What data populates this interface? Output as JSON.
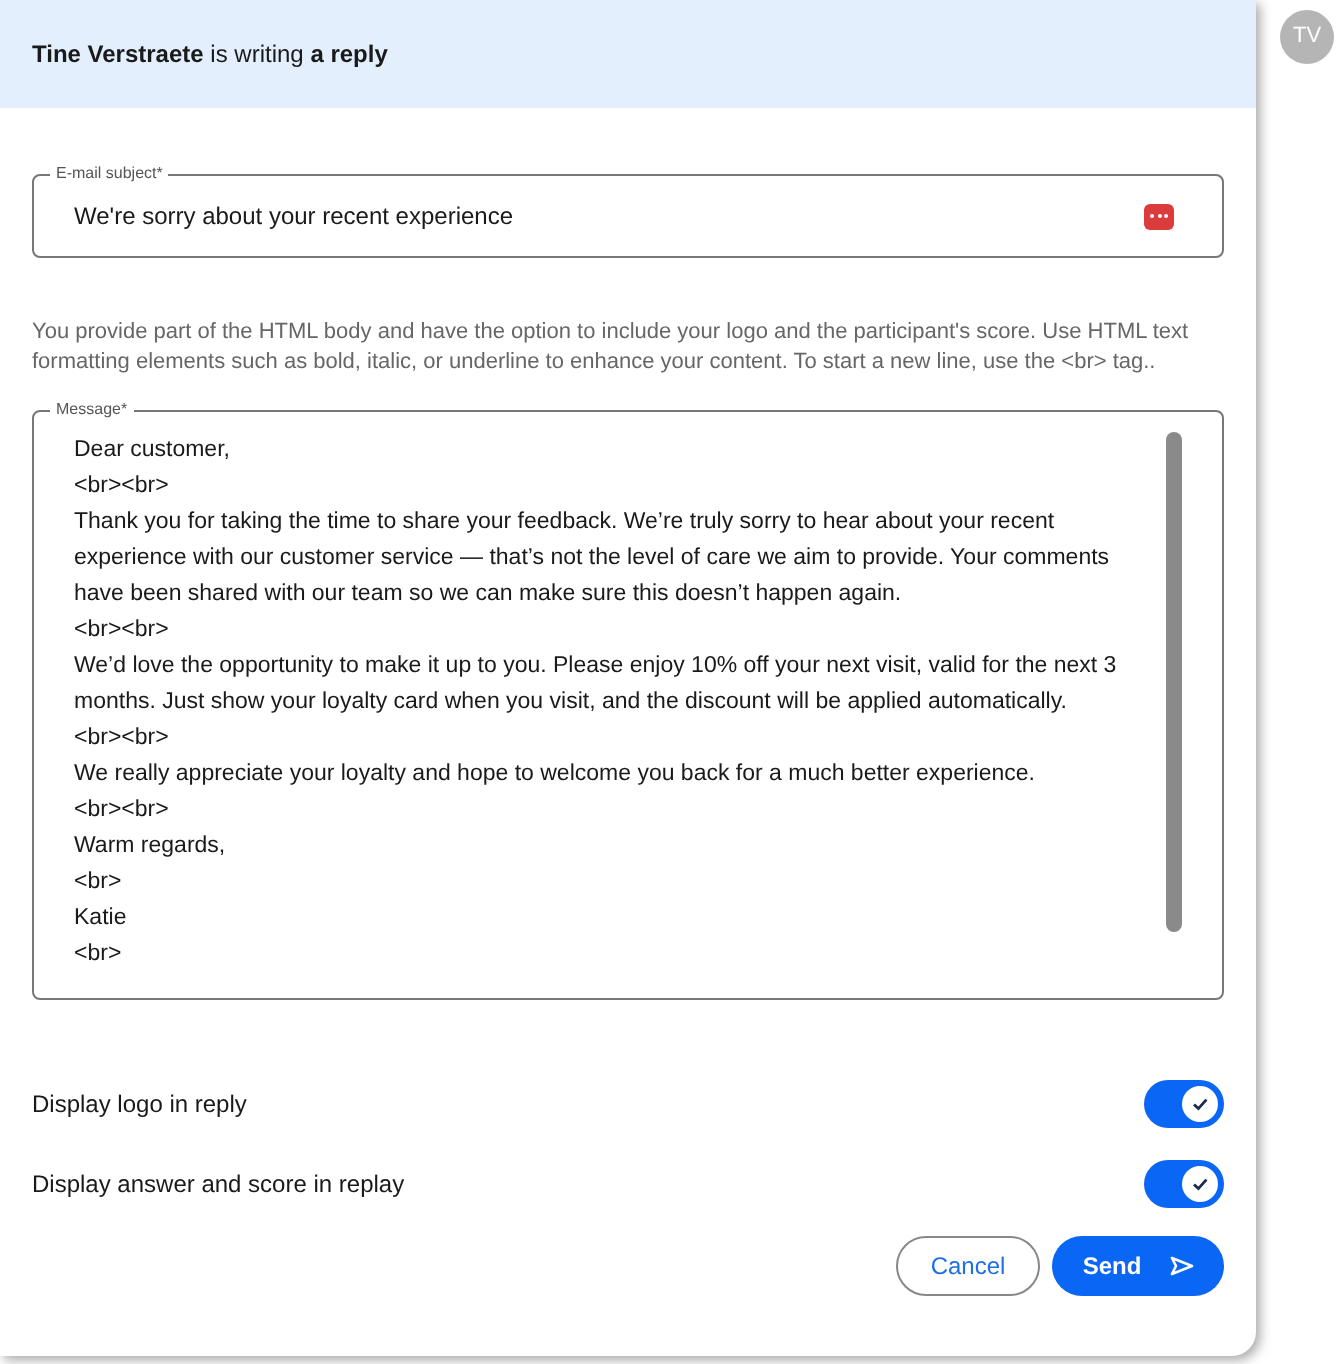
{
  "header": {
    "author": "Tine Verstraete",
    "action": "is writing",
    "object": "a reply"
  },
  "avatar": {
    "initials": "TV"
  },
  "subject": {
    "label": "E-mail subject*",
    "value": "We're sorry about your recent experience"
  },
  "help_text": "You provide part of the HTML body and have the option to include your logo and the participant's score. Use HTML text formatting elements such as bold, italic, or underline to enhance your content. To start a new line, use the <br> tag..",
  "message": {
    "label": "Message*",
    "lines": [
      "Dear customer,",
      "<br><br>",
      "Thank you for taking the time to share your feedback. We’re truly sorry to hear about your recent experience with our customer service — that’s not the level of care we aim to provide. Your comments have been shared with our team so we can make sure this doesn’t happen again.",
      "<br><br>",
      "We’d love the opportunity to make it up to you. Please enjoy 10% off your next visit, valid for the next 3 months. Just show your loyalty card when you visit, and the discount will be applied automatically.",
      "<br><br>",
      "We really appreciate your loyalty and hope to welcome you back for a much better experience.",
      "<br><br>",
      "Warm regards,",
      "<br>",
      "Katie",
      "<br>"
    ]
  },
  "options": [
    {
      "label": "Display logo in reply",
      "on": true
    },
    {
      "label": "Display answer and score in replay",
      "on": true
    }
  ],
  "buttons": {
    "cancel": "Cancel",
    "send": "Send"
  }
}
